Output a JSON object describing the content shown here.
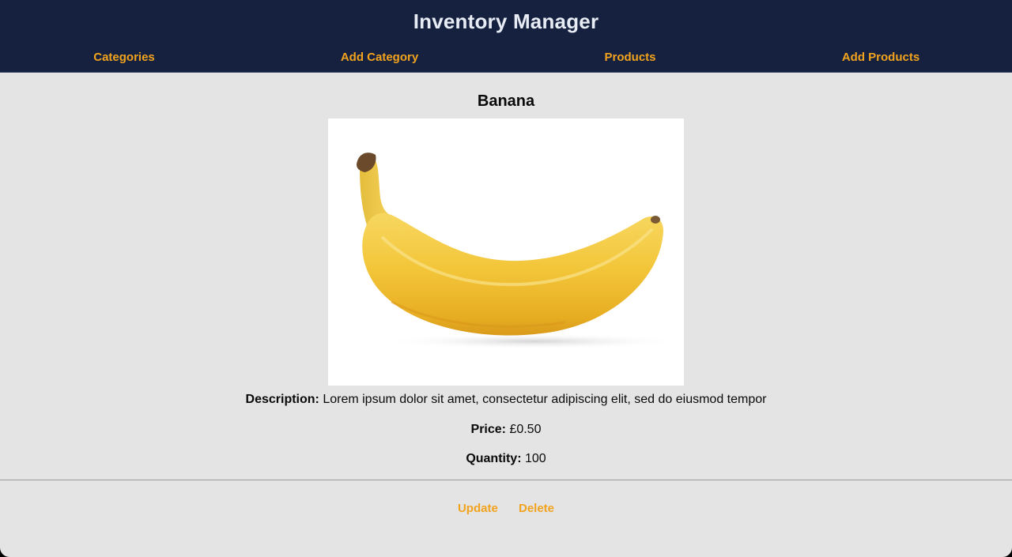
{
  "header": {
    "title": "Inventory Manager"
  },
  "nav": {
    "items": [
      {
        "label": "Categories"
      },
      {
        "label": "Add Category"
      },
      {
        "label": "Products"
      },
      {
        "label": "Add Products"
      }
    ]
  },
  "product": {
    "name": "Banana",
    "image": "banana-photo",
    "description_label": "Description:",
    "description": "Lorem ipsum dolor sit amet, consectetur adipiscing elit, sed do eiusmod tempor",
    "price_label": "Price:",
    "price": "£0.50",
    "quantity_label": "Quantity:",
    "quantity": "100"
  },
  "actions": {
    "update_label": "Update",
    "delete_label": "Delete"
  },
  "colors": {
    "header_bg": "#15213f",
    "accent": "#f2a31e",
    "page_bg": "#e4e4e4"
  }
}
